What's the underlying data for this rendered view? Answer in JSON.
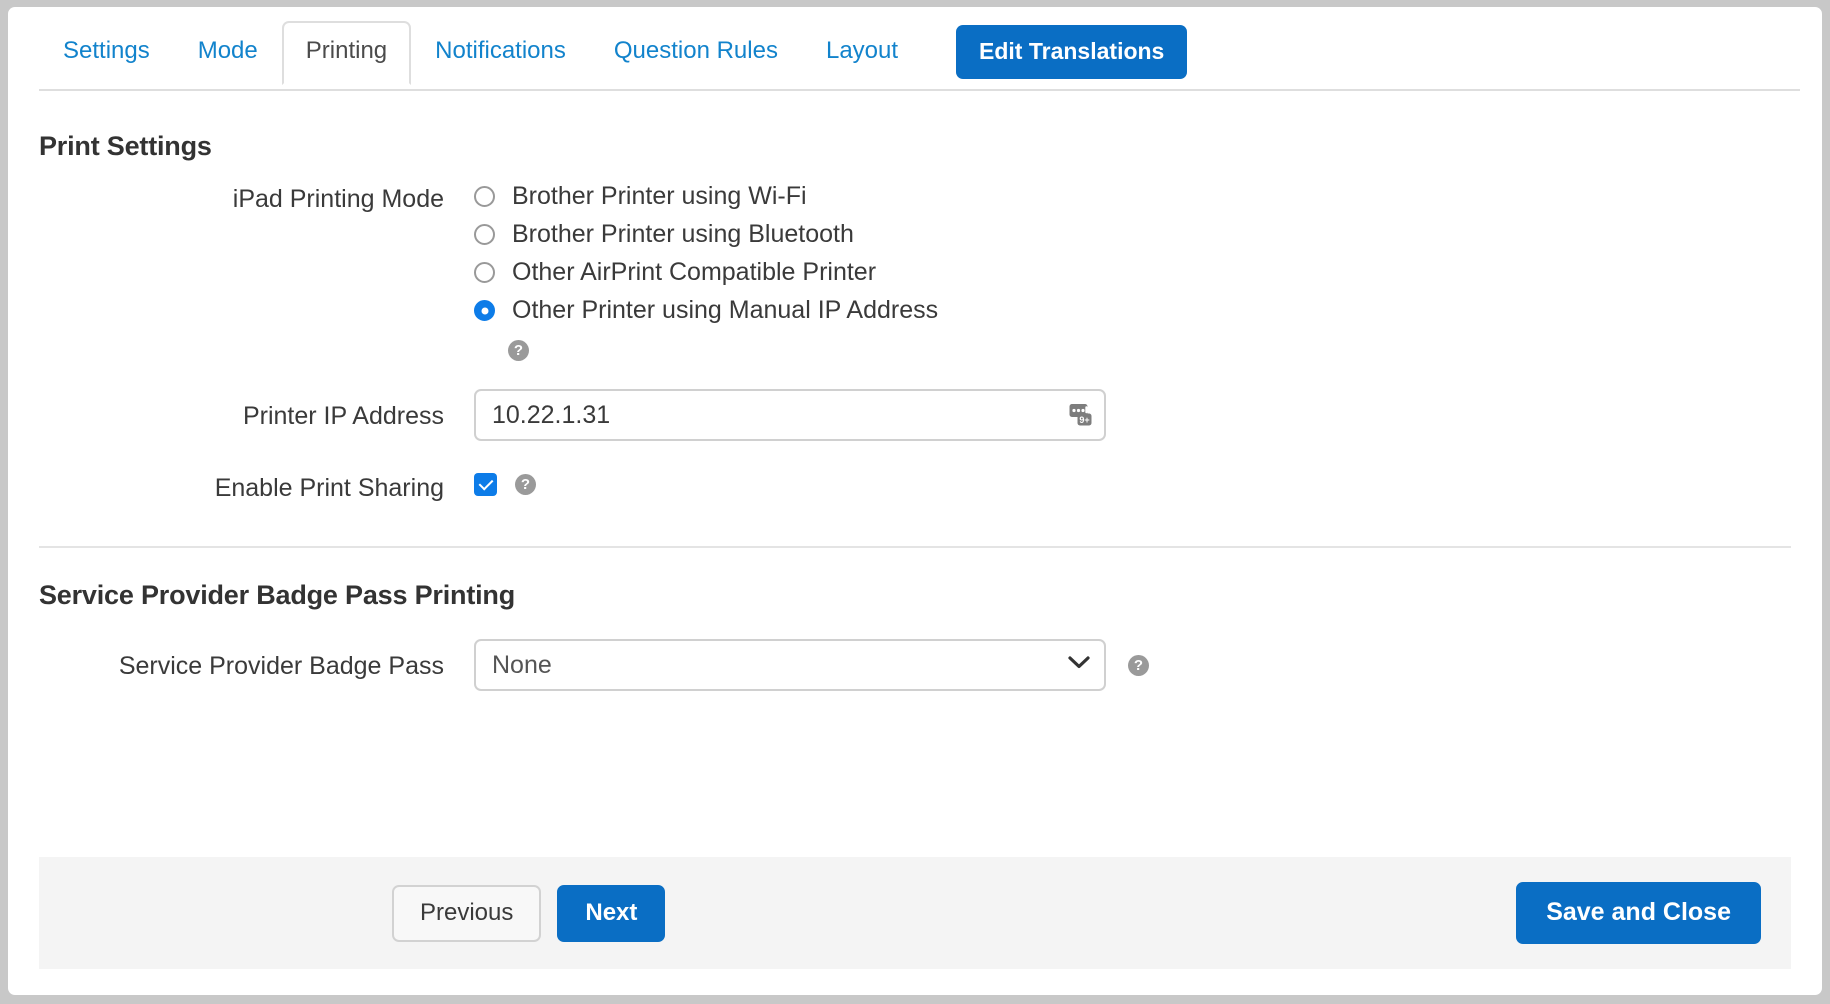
{
  "tabs": [
    {
      "label": "Settings",
      "active": false
    },
    {
      "label": "Mode",
      "active": false
    },
    {
      "label": "Printing",
      "active": true
    },
    {
      "label": "Notifications",
      "active": false
    },
    {
      "label": "Question Rules",
      "active": false
    },
    {
      "label": "Layout",
      "active": false
    }
  ],
  "header": {
    "edit_translations_label": "Edit Translations"
  },
  "print_settings": {
    "section_title": "Print Settings",
    "ipad_printing_mode": {
      "label": "iPad Printing Mode",
      "options": [
        {
          "label": "Brother Printer using Wi-Fi",
          "selected": false
        },
        {
          "label": "Brother Printer using Bluetooth",
          "selected": false
        },
        {
          "label": "Other AirPrint Compatible Printer",
          "selected": false
        },
        {
          "label": "Other Printer using Manual IP Address",
          "selected": true
        }
      ],
      "help_icon": "help-circle-icon",
      "help_glyph": "?"
    },
    "printer_ip": {
      "label": "Printer IP Address",
      "value": "10.22.1.31",
      "placeholder": "",
      "trailing_icon": "password-manager-icon",
      "trailing_icon_badge": "9+"
    },
    "print_sharing": {
      "label": "Enable Print Sharing",
      "checked": true,
      "help_icon": "help-circle-icon",
      "help_glyph": "?"
    }
  },
  "badge_pass": {
    "section_title": "Service Provider Badge Pass Printing",
    "field": {
      "label": "Service Provider Badge Pass",
      "selected_value": "None",
      "options": [
        "None"
      ],
      "chevron_icon": "chevron-down-icon",
      "help_icon": "help-circle-icon",
      "help_glyph": "?"
    }
  },
  "footer": {
    "previous_label": "Previous",
    "next_label": "Next",
    "save_and_close_label": "Save and Close"
  },
  "colors": {
    "accent_blue": "#0a6ec4",
    "link_blue": "#1283cc",
    "control_blue": "#0d7ce8",
    "footer_bg": "#f4f4f4",
    "border_gray": "#d0d0d0",
    "help_gray": "#9a9a9a"
  }
}
